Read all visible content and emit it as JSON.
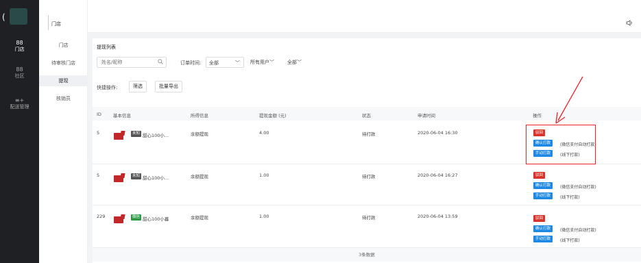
{
  "sidebar": {
    "items": [
      {
        "icon": "88",
        "label": "门店",
        "active": true
      },
      {
        "icon": "88",
        "label": "社区",
        "active": false
      },
      {
        "icon": "≡+",
        "label": "配送管理",
        "active": false
      }
    ]
  },
  "header": {
    "section_title": "门店"
  },
  "subnav": {
    "items": [
      {
        "label": "门店",
        "active": false
      },
      {
        "label": "待审核门店",
        "active": false
      },
      {
        "label": "提现",
        "active": true
      },
      {
        "label": "核销员",
        "active": false
      }
    ]
  },
  "panel": {
    "title": "提现列表",
    "search": {
      "placeholder": "姓名/昵称"
    },
    "order_time_label": "订单时间:",
    "order_time_value": "全部",
    "user_filter": "所有用户",
    "status_filter": "全部",
    "quick_label": "快捷操作:",
    "filter_button": "筛选",
    "export_button": "批量导出"
  },
  "table": {
    "headers": [
      "ID",
      "基本信息",
      "所得信息",
      "提现金额 (元)",
      "状态",
      "申请时间",
      "操作"
    ],
    "rows": [
      {
        "id": "5",
        "tag": "未知",
        "tag_type": "unknown",
        "name": "甜心100小...",
        "source": "余额提现",
        "amount": "4.00",
        "status": "待打款",
        "time": "2020-06-04 16:30"
      },
      {
        "id": "5",
        "tag": "未知",
        "tag_type": "unknown",
        "name": "甜心100小...",
        "source": "余额提现",
        "amount": "1.00",
        "status": "待打款",
        "time": "2020-06-04 16:27"
      },
      {
        "id": "229",
        "tag": "微信",
        "tag_type": "wechat",
        "name": "甜心100小暮",
        "source": "余额提现",
        "amount": "1.00",
        "status": "待打款",
        "time": "2020-06-04 13:59"
      }
    ],
    "actions": {
      "reject": "驳回",
      "confirm": "确认打款",
      "confirm_note": "(微信支付自动打款)",
      "manual": "手动打款",
      "manual_note": "(线下打款)"
    },
    "count_text": "3条数据"
  },
  "colors": {
    "sidebar": "#1f2024",
    "reject": "#d9342b",
    "primary": "#1e88e5",
    "annotation": "#e8232a"
  },
  "icons": {
    "search": "search-icon",
    "volume": "volume-icon"
  }
}
